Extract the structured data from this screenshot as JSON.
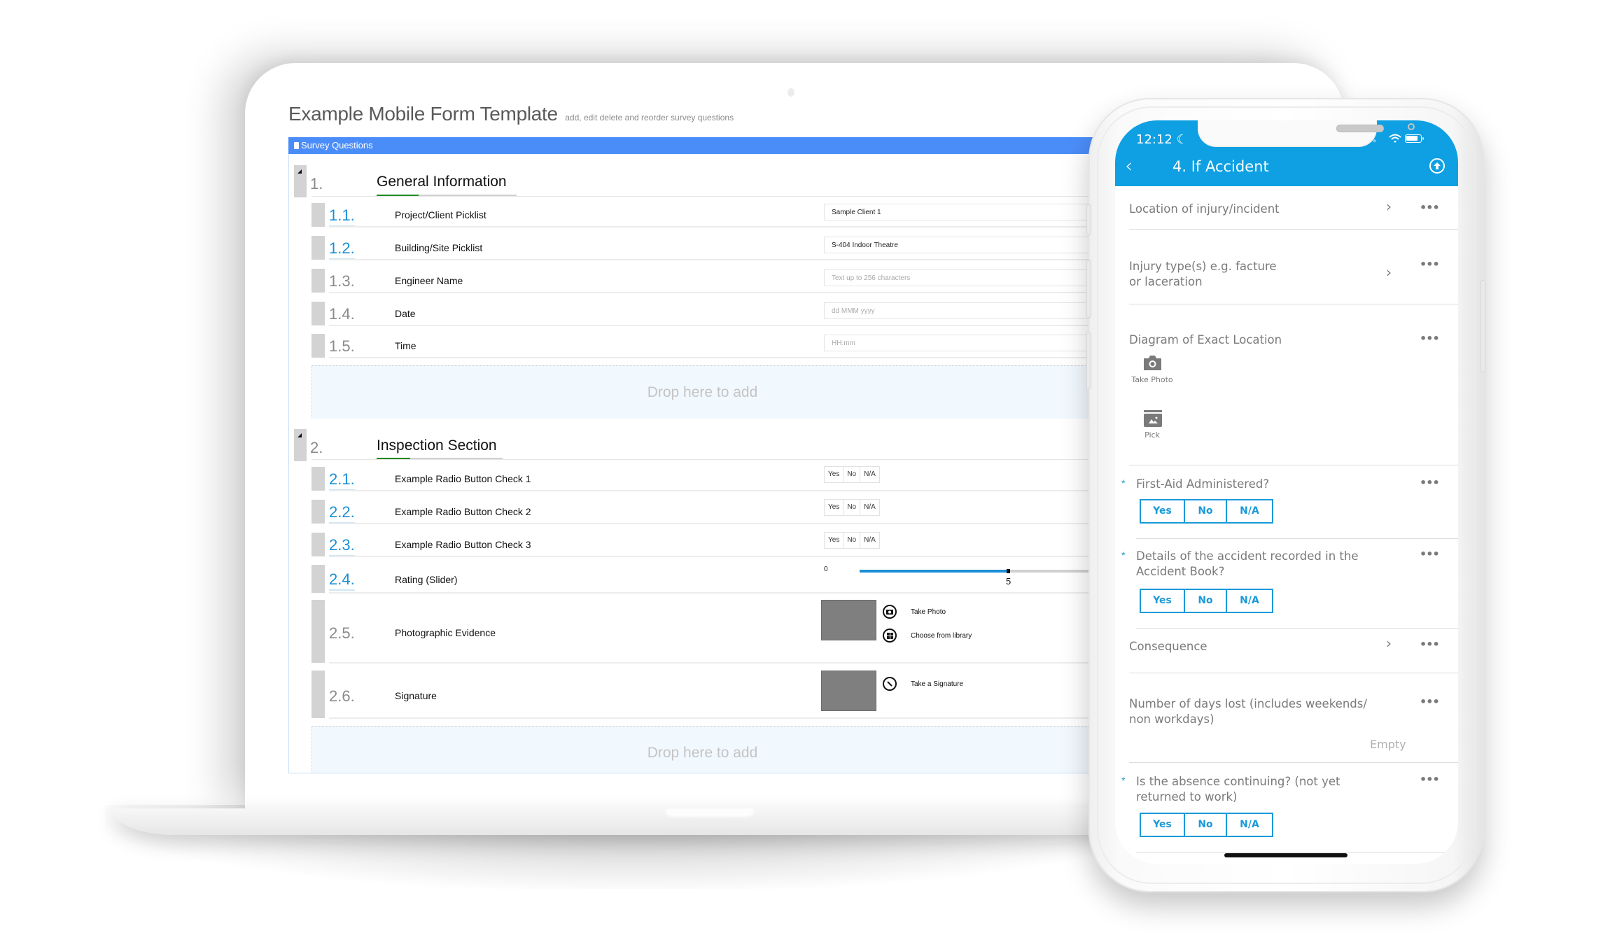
{
  "laptop": {
    "title": "Example Mobile Form Template",
    "subtitle": "add, edit delete and reorder survey questions",
    "panel_title": "Survey Questions",
    "drop_label": "Drop here to add",
    "sections": [
      {
        "number": "1.",
        "title": "General Information",
        "questions": [
          {
            "number": "1.1.",
            "label": "Project/Client Picklist",
            "type": "picklist",
            "value": "Sample Client 1",
            "answered": true
          },
          {
            "number": "1.2.",
            "label": "Building/Site Picklist",
            "type": "picklist",
            "value": "S-404 Indoor Theatre",
            "answered": true
          },
          {
            "number": "1.3.",
            "label": "Engineer Name",
            "type": "text",
            "placeholder": "Text up to 256 characters",
            "answered": false
          },
          {
            "number": "1.4.",
            "label": "Date",
            "type": "date",
            "placeholder": "dd MMM yyyy",
            "answered": false
          },
          {
            "number": "1.5.",
            "label": "Time",
            "type": "time",
            "placeholder": "HH:mm",
            "answered": false
          }
        ]
      },
      {
        "number": "2.",
        "title": "Inspection Section",
        "questions": [
          {
            "number": "2.1.",
            "label": "Example Radio Button Check 1",
            "type": "radio",
            "options": [
              "Yes",
              "No",
              "N/A"
            ],
            "answered": true
          },
          {
            "number": "2.2.",
            "label": "Example Radio Button Check 2",
            "type": "radio",
            "options": [
              "Yes",
              "No",
              "N/A"
            ],
            "answered": true
          },
          {
            "number": "2.3.",
            "label": "Example Radio Button Check 3",
            "type": "radio",
            "options": [
              "Yes",
              "No",
              "N/A"
            ],
            "answered": true
          },
          {
            "number": "2.4.",
            "label": "Rating (Slider)",
            "type": "slider",
            "min_label": "0",
            "value": 5,
            "value_label": "5",
            "answered": true
          },
          {
            "number": "2.5.",
            "label": "Photographic Evidence",
            "type": "photo",
            "actions": [
              "Take Photo",
              "Choose from library"
            ],
            "answered": false
          },
          {
            "number": "2.6.",
            "label": "Signature",
            "type": "signature",
            "actions": [
              "Take a Signature"
            ],
            "answered": false
          }
        ]
      }
    ]
  },
  "phone": {
    "status_time": "12:12",
    "header_title": "4. If Accident",
    "items": [
      {
        "label": "Location of injury/incident",
        "chevron": true,
        "required": false
      },
      {
        "label": "Injury type(s) e.g. facture or laceration",
        "line1": "Injury type(s) e.g. facture",
        "line2": "or laceration",
        "chevron": true,
        "required": false
      },
      {
        "label": "Diagram of Exact Location",
        "actions": [
          "Take Photo",
          "Pick"
        ],
        "required": false
      },
      {
        "label": "First-Aid Administered?",
        "options": [
          "Yes",
          "No",
          "N/A"
        ],
        "required": true
      },
      {
        "label": "Details of the accident recorded in the Accident Book?",
        "line1": "Details of the accident recorded in the",
        "line2": "Accident Book?",
        "options": [
          "Yes",
          "No",
          "N/A"
        ],
        "required": true
      },
      {
        "label": "Consequence",
        "chevron": true,
        "required": false
      },
      {
        "label": "Number of days lost (includes weekends/ non workdays)",
        "line1": "Number of days lost (includes weekends/",
        "line2": "non workdays)",
        "value": "Empty",
        "required": false
      },
      {
        "label": "Is the absence continuing? (not yet returned to work)",
        "line1": "Is the absence continuing? (not yet",
        "line2": "returned to work)",
        "options": [
          "Yes",
          "No",
          "N/A"
        ],
        "required": true
      }
    ],
    "required_marker": "*",
    "more_glyph": "•••",
    "chevron_glyph": "›"
  },
  "colors": {
    "panel_blue": "#4b8df8",
    "link_blue": "#1a8fd6",
    "app_header": "#0ea0e2",
    "section_accent": "#1f8a1f"
  }
}
